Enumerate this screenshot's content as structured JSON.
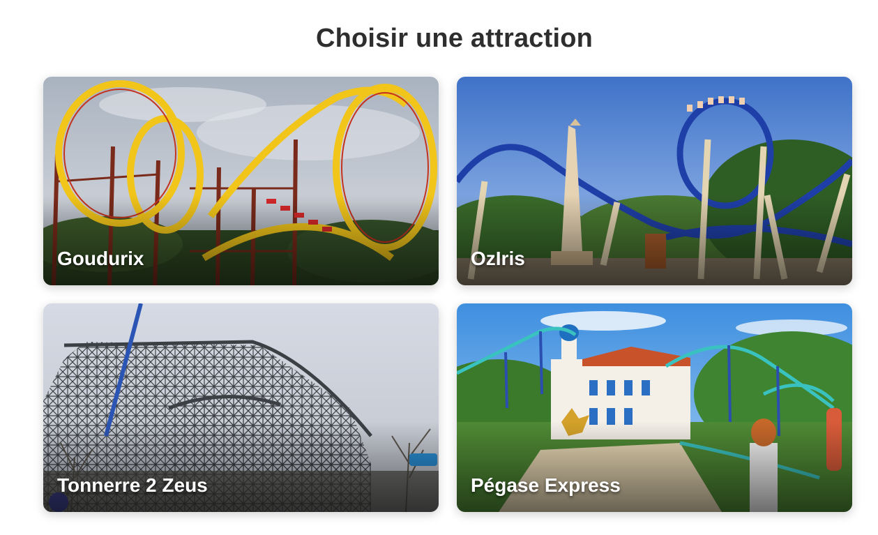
{
  "page": {
    "title": "Choisir une attraction"
  },
  "attractions": [
    {
      "name": "Goudurix",
      "image": "goudurix-coaster-photo"
    },
    {
      "name": "OzIris",
      "image": "oziris-coaster-photo"
    },
    {
      "name": "Tonnerre 2 Zeus",
      "image": "tonnerre-2-zeus-coaster-photo"
    },
    {
      "name": "Pégase Express",
      "image": "pegase-express-coaster-photo"
    }
  ]
}
